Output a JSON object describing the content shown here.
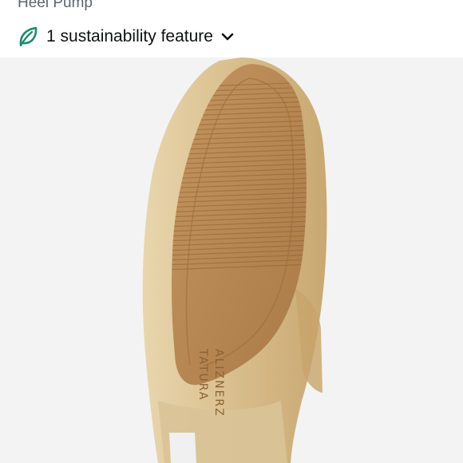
{
  "product": {
    "title_fragment": "Heel Pump"
  },
  "sustainability": {
    "label": "1 sustainability feature",
    "icon": "leaf-icon",
    "icon_color": "#1d8a6d",
    "chevron_icon": "chevron-down-icon"
  },
  "image": {
    "brand_imprint_line1": "ALIZNERZ",
    "brand_imprint_line2": "TATURA",
    "sole_color": "#b98a56",
    "upper_color": "#d8be8c",
    "background_color": "#f3f3f3"
  }
}
